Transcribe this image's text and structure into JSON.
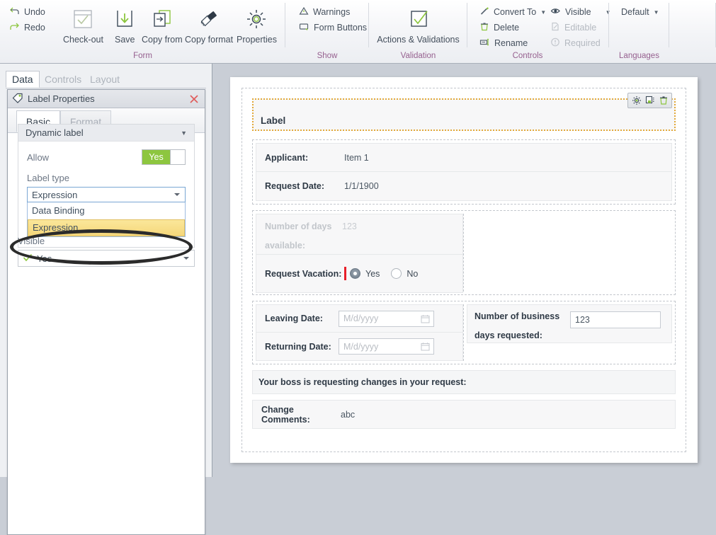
{
  "ribbon": {
    "groups": [
      {
        "name": "Form",
        "label": "Form",
        "small_buttons": [
          {
            "label": "Undo",
            "icon": "undo-icon"
          },
          {
            "label": "Redo",
            "icon": "redo-icon"
          }
        ],
        "big_buttons": [
          {
            "label": "Check-out",
            "icon": "check-out-icon"
          },
          {
            "label": "Save",
            "icon": "save-icon"
          },
          {
            "label": "Copy from",
            "icon": "copy-from-icon"
          },
          {
            "label": "Copy format",
            "icon": "copy-format-icon"
          },
          {
            "label": "Properties",
            "icon": "properties-gear-icon"
          }
        ]
      },
      {
        "name": "Show",
        "label": "Show",
        "small_buttons": [
          {
            "label": "Warnings",
            "icon": "warning-triangle-icon"
          },
          {
            "label": "Form Buttons",
            "icon": "form-buttons-icon"
          }
        ]
      },
      {
        "name": "Validation",
        "label": "Validation",
        "big_buttons": [
          {
            "label": "Actions & Validations",
            "icon": "checkmark-box-icon"
          }
        ]
      },
      {
        "name": "Controls",
        "label": "Controls",
        "small_buttons": [
          {
            "label": "Convert To",
            "icon": "convert-to-wand-icon",
            "dropdown": true
          },
          {
            "label": "Delete",
            "icon": "trash-icon"
          },
          {
            "label": "Rename",
            "icon": "rename-icon"
          },
          {
            "label": "Visible",
            "icon": "eye-icon",
            "dropdown": true
          },
          {
            "label": "Editable",
            "icon": "editable-pencil-icon",
            "disabled": true
          },
          {
            "label": "Required",
            "icon": "required-exclamation-icon",
            "disabled": true
          }
        ]
      },
      {
        "name": "Languages",
        "label": "Languages",
        "small_buttons": [
          {
            "label": "Default",
            "dropdown": true
          }
        ]
      }
    ]
  },
  "left_panel": {
    "tabs": [
      {
        "label": "Data",
        "selected": true
      },
      {
        "label": "Controls",
        "selected": false
      },
      {
        "label": "Layout",
        "selected": false
      }
    ],
    "properties": {
      "title": "Label Properties",
      "title_icon": "tag-icon",
      "close_icon": "close-icon",
      "subtabs": [
        {
          "label": "Basic",
          "selected": true
        },
        {
          "label": "Format",
          "selected": false
        }
      ],
      "section": {
        "header": "Dynamic label",
        "caret": "▼",
        "allow": {
          "label": "Allow",
          "value": "Yes"
        },
        "label_type": {
          "label": "Label type",
          "value": "Expression",
          "options": [
            "Data Binding",
            "Expression"
          ],
          "highlighted_option": "Expression",
          "open": true
        }
      },
      "visible": {
        "label": "Visible",
        "value": "Yes",
        "icon": "green-check-icon"
      }
    }
  },
  "canvas": {
    "label_widget": {
      "text": "Label",
      "tools": [
        {
          "icon": "gear-icon",
          "name": "widget-properties"
        },
        {
          "icon": "duplicate-icon",
          "name": "widget-duplicate"
        },
        {
          "icon": "trash-icon",
          "name": "widget-delete"
        }
      ]
    },
    "rows": [
      {
        "label": "Applicant:",
        "value": "Item 1",
        "type": "text"
      },
      {
        "label": "Request Date:",
        "value": "1/1/1900",
        "type": "text"
      }
    ],
    "days_available": {
      "label_line1": "Number of days",
      "label_line2": "available:",
      "value": "123",
      "disabled": true
    },
    "request_vacation": {
      "label": "Request Vacation:",
      "required": true,
      "options": [
        {
          "label": "Yes",
          "selected": true
        },
        {
          "label": "No",
          "selected": false
        }
      ]
    },
    "dates": {
      "leaving": {
        "label": "Leaving Date:",
        "placeholder": "M/d/yyyy",
        "value": "",
        "icon": "calendar-icon"
      },
      "returning": {
        "label": "Returning Date:",
        "placeholder": "M/d/yyyy",
        "value": "",
        "icon": "calendar-icon"
      }
    },
    "business_days": {
      "label_line1": "Number of business",
      "label_line2": "days requested:",
      "value": "123"
    },
    "boss_banner": "Your boss is requesting changes in your request:",
    "change_comments": {
      "label": "Change Comments:",
      "value": "abc"
    }
  },
  "colors": {
    "accent_green": "#8dc63f",
    "selection_yellow": "#f5d77a",
    "required_red": "#e8202a",
    "group_label": "#96608f",
    "widget_border": "#e2a93a"
  }
}
